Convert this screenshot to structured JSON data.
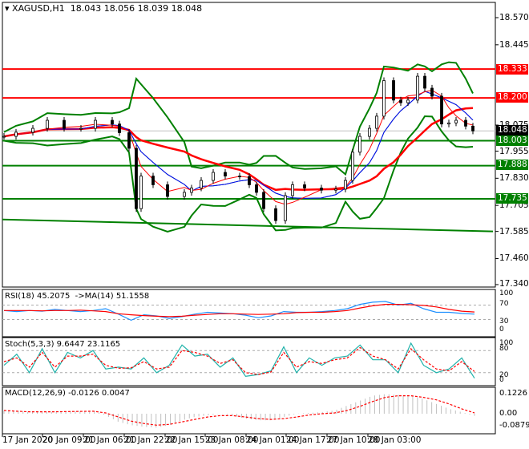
{
  "header": {
    "symbol": "XAGUSD,H1",
    "ohlc": "18.043 18.056 18.039 18.048"
  },
  "colors": {
    "up": "#000000",
    "down": "#000000",
    "ma_fast": "#ff0000",
    "ma_slow": "#0000ff",
    "bands": "#008000",
    "resistance": "#ff0000",
    "support": "#008000",
    "rsi": "#1e90ff",
    "rsi_ma": "#ff0000",
    "stoch_main": "#20b2aa",
    "stoch_signal": "#ff0000",
    "macd_hist": "#c0c0c0",
    "macd_signal": "#ff0000"
  },
  "price_axis": {
    "ticks": [
      "18.570",
      "18.445",
      "18.075",
      "17.955",
      "17.830",
      "17.705",
      "17.585",
      "17.460",
      "17.340"
    ],
    "current": "18.048"
  },
  "levels": [
    {
      "value": "18.333",
      "type": "resistance"
    },
    {
      "value": "18.200",
      "type": "resistance"
    },
    {
      "value": "18.003",
      "type": "support"
    },
    {
      "value": "17.888",
      "type": "support"
    },
    {
      "value": "17.735",
      "type": "support"
    }
  ],
  "time_axis": [
    "17 Jan 2020",
    "20 Jan 09:00",
    "21 Jan 06:00",
    "21 Jan 22:00",
    "22 Jan 15:00",
    "23 Jan 08:00",
    "24 Jan 01:00",
    "24 Jan 17:00",
    "27 Jan 10:00",
    "28 Jan 03:00"
  ],
  "rsi": {
    "label": "RSI(18) 45.2075  ->MA(14) 51.1558",
    "levels": [
      "100",
      "70",
      "30",
      "0"
    ]
  },
  "stoch": {
    "label": "Stoch(5,3,3) 9.6447 23.1165",
    "levels": [
      "100",
      "80",
      "20",
      "0"
    ]
  },
  "macd": {
    "label": "MACD(12,26,9) -0.0126 0.0047",
    "levels": [
      "0.1226",
      "0.00",
      "-0.0879"
    ]
  },
  "chart_data": {
    "type": "candlestick",
    "title": "XAGUSD,H1",
    "ylim": [
      17.34,
      18.6
    ],
    "trendline": [
      17.64,
      17.585
    ],
    "bars": [
      0,
      5,
      12,
      18,
      25,
      32,
      38,
      45,
      48,
      52,
      55,
      57,
      62,
      68,
      75,
      78,
      82,
      87,
      92,
      98,
      102,
      105,
      108,
      113,
      117,
      120,
      125,
      132,
      138,
      142,
      145,
      148,
      152,
      155,
      158,
      162,
      165,
      168,
      172,
      175,
      178,
      182,
      185,
      188,
      192,
      195
    ],
    "close": [
      18.023,
      18.042,
      18.06,
      18.097,
      18.06,
      18.06,
      18.097,
      18.08,
      18.04,
      17.968,
      17.69,
      17.84,
      17.8,
      17.746,
      17.765,
      17.785,
      17.82,
      17.857,
      17.84,
      17.838,
      17.8,
      17.765,
      17.69,
      17.635,
      17.75,
      17.8,
      17.785,
      17.775,
      17.78,
      17.82,
      17.95,
      18.023,
      18.06,
      18.116,
      18.28,
      18.19,
      18.178,
      18.19,
      18.3,
      18.245,
      18.208,
      18.08,
      18.085,
      18.097,
      18.07,
      18.048
    ],
    "rsi": [
      55,
      52,
      55,
      53,
      58,
      55,
      52,
      55,
      60,
      45,
      28,
      43,
      40,
      33,
      38,
      45,
      50,
      48,
      46,
      42,
      35,
      40,
      52,
      50,
      50,
      52,
      55,
      60,
      72,
      78,
      80,
      70,
      75,
      60,
      50,
      50,
      47,
      45
    ],
    "rsi_ma": [
      55,
      55,
      55,
      54,
      55,
      55,
      56,
      54,
      52,
      46,
      43,
      41,
      39,
      38,
      39,
      42,
      44,
      46,
      46,
      45,
      44,
      45,
      46,
      49,
      50,
      50,
      52,
      55,
      62,
      68,
      72,
      72,
      71,
      69,
      65,
      58,
      53,
      51
    ],
    "stoch_main": [
      40,
      70,
      20,
      85,
      20,
      75,
      60,
      80,
      30,
      35,
      30,
      60,
      20,
      40,
      95,
      65,
      70,
      35,
      60,
      10,
      15,
      25,
      90,
      20,
      60,
      40,
      60,
      65,
      95,
      55,
      55,
      20,
      100,
      40,
      20,
      30,
      60,
      5
    ],
    "stoch_signal": [
      50,
      60,
      35,
      75,
      35,
      65,
      65,
      70,
      40,
      32,
      33,
      50,
      30,
      35,
      80,
      75,
      65,
      45,
      55,
      20,
      15,
      22,
      75,
      35,
      50,
      45,
      55,
      60,
      88,
      65,
      55,
      30,
      85,
      55,
      30,
      25,
      50,
      23
    ],
    "macd_hist": [
      0.02,
      0.015,
      0.012,
      0.01,
      0.01,
      0.012,
      0.015,
      0.02,
      -0.01,
      -0.05,
      -0.07,
      -0.08,
      -0.085,
      -0.07,
      -0.04,
      -0.02,
      -0.01,
      0.0,
      -0.01,
      -0.03,
      -0.04,
      -0.04,
      -0.02,
      0.0,
      0.005,
      0.01,
      0.02,
      0.05,
      0.08,
      0.11,
      0.12,
      0.115,
      0.11,
      0.09,
      0.06,
      0.03,
      0.01,
      -0.013
    ],
    "macd_signal": [
      0.02,
      0.015,
      0.012,
      0.012,
      0.012,
      0.013,
      0.014,
      0.015,
      0.005,
      -0.02,
      -0.045,
      -0.06,
      -0.07,
      -0.065,
      -0.05,
      -0.035,
      -0.02,
      -0.012,
      -0.012,
      -0.02,
      -0.03,
      -0.035,
      -0.03,
      -0.02,
      -0.008,
      0.0,
      0.005,
      0.02,
      0.045,
      0.075,
      0.1,
      0.11,
      0.11,
      0.1,
      0.085,
      0.06,
      0.03,
      0.005
    ]
  }
}
